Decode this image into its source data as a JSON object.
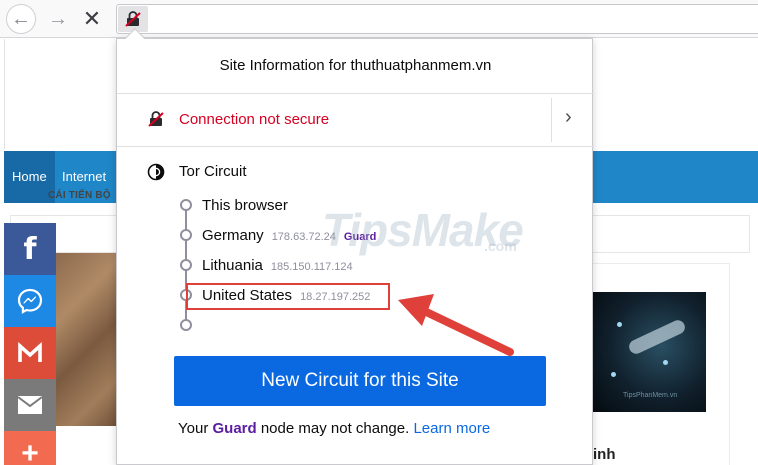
{
  "toolbar": {
    "back_icon": "back-arrow-icon",
    "forward_icon": "forward-arrow-icon",
    "stop_icon": "stop-icon",
    "identity_icon": "insecure-lock-icon"
  },
  "site": {
    "nav": [
      "Home",
      "Internet"
    ],
    "ticker_text": "CÁI TIẾN BỘ",
    "heading_fragment": "inh",
    "image_watermark": "TipsPhanMem.vn"
  },
  "social": [
    "facebook-icon",
    "messenger-icon",
    "gmail-icon",
    "email-icon",
    "more-icon"
  ],
  "panel": {
    "title": "Site Information for thuthuatphanmem.vn",
    "connection": "Connection not secure",
    "tor_title": "Tor Circuit",
    "nodes": [
      {
        "name": "This browser",
        "ip": "",
        "tag": ""
      },
      {
        "name": "Germany",
        "ip": "178.63.72.24",
        "tag": "Guard"
      },
      {
        "name": "Lithuania",
        "ip": "185.150.117.124",
        "tag": ""
      },
      {
        "name": "United States",
        "ip": "18.27.197.252",
        "tag": ""
      }
    ],
    "new_circuit_button": "New Circuit for this Site",
    "footer": {
      "pre": "Your ",
      "guard": "Guard",
      "mid": " node may not change. ",
      "link": "Learn more"
    }
  },
  "watermark": {
    "main": "TipsMake",
    "suffix": ".com"
  },
  "colors": {
    "insecure": "#d70022",
    "button": "#0a69e0",
    "guard": "#5b1da0",
    "nav": "#1f86c8",
    "annotation": "#e0403a"
  }
}
